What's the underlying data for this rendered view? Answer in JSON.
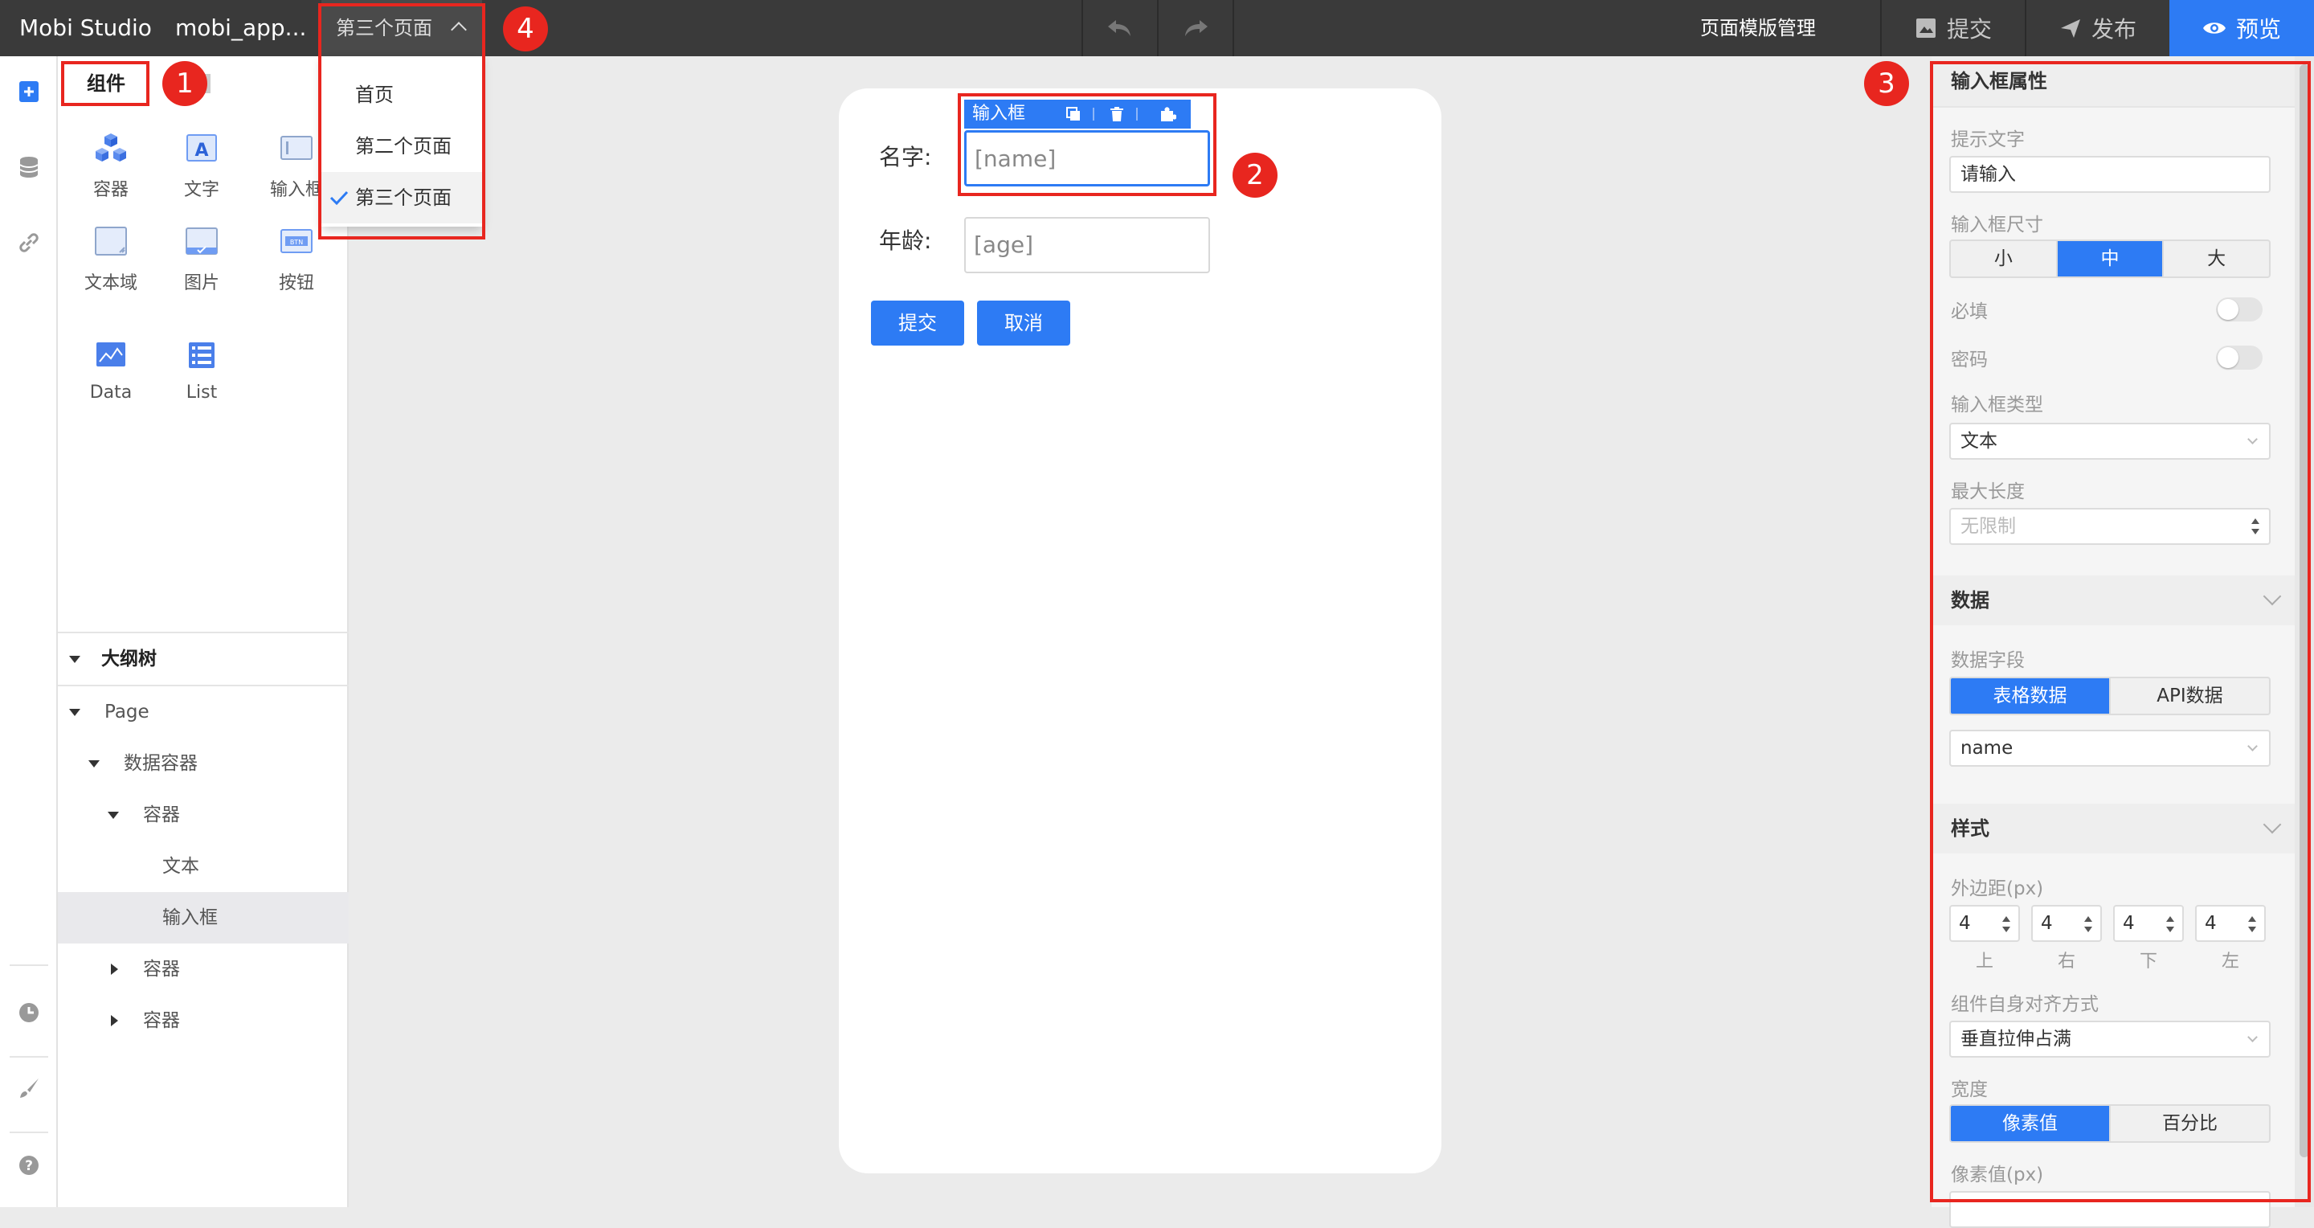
{
  "topbar": {
    "app_name": "Mobi Studio",
    "project_name": "mobi_app...",
    "page_selector": "第三个页面",
    "template_manage": "页面模版管理",
    "submit": "提交",
    "publish": "发布",
    "preview": "预览"
  },
  "page_dropdown": {
    "items": [
      "首页",
      "第二个页面",
      "第三个页面"
    ],
    "selected_index": 2
  },
  "components": {
    "tab_label": "组件",
    "items": [
      "容器",
      "文字",
      "输入框",
      "文本域",
      "图片",
      "按钮",
      "Data",
      "List"
    ]
  },
  "outline": {
    "title": "大纲树",
    "rows": [
      "Page",
      "数据容器",
      "容器",
      "文本",
      "输入框",
      "容器",
      "容器"
    ]
  },
  "canvas": {
    "toolbar_label": "输入框",
    "name_label": "名字:",
    "name_value": "[name]",
    "age_label": "年龄:",
    "age_value": "[age]",
    "submit_btn": "提交",
    "cancel_btn": "取消"
  },
  "props": {
    "section_title": "输入框属性",
    "hint_label": "提示文字",
    "hint_value": "请输入",
    "size_label": "输入框尺寸",
    "size_options": [
      "小",
      "中",
      "大"
    ],
    "size_selected": 1,
    "required_label": "必填",
    "password_label": "密码",
    "type_label": "输入框类型",
    "type_value": "文本",
    "maxlen_label": "最大长度",
    "maxlen_placeholder": "无限制",
    "data_title": "数据",
    "data_field_label": "数据字段",
    "data_source_options": [
      "表格数据",
      "API数据"
    ],
    "data_field_value": "name",
    "style_title": "样式",
    "margin_label": "外边距(px)",
    "margins": [
      "4",
      "4",
      "4",
      "4"
    ],
    "margin_captions": [
      "上",
      "右",
      "下",
      "左"
    ],
    "align_label": "组件自身对齐方式",
    "align_value": "垂直拉伸占满",
    "width_label": "宽度",
    "width_options": [
      "像素值",
      "百分比"
    ],
    "pixel_label": "像素值(px)"
  },
  "annotations": [
    "1",
    "2",
    "3",
    "4"
  ],
  "colors": {
    "accent": "#2d7bf4",
    "annotation": "#e8261f",
    "topbar": "#3a3a3a"
  }
}
